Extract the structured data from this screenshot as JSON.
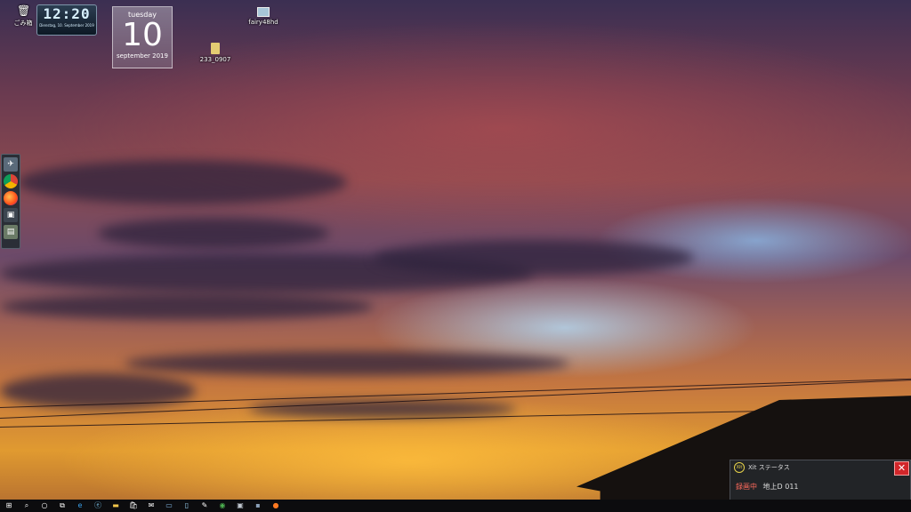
{
  "desktop": {
    "icons": [
      {
        "label": "ごみ箱",
        "icon": "recycle-bin-icon"
      },
      {
        "label": "fairy48hd",
        "icon": "image-file-icon"
      },
      {
        "label": "233_0907",
        "icon": "file-archive-icon"
      }
    ]
  },
  "clock": {
    "time": "12:20",
    "date": "Dienstag, 10. September 2019"
  },
  "calendar": {
    "day": "tuesday",
    "number": "10",
    "month": "september 2019"
  },
  "status_panel": {
    "title": "Xit ステータス",
    "recording": "録画中",
    "channel": "地上D 011",
    "close": "✕"
  },
  "colors": {
    "accent_close": "#d2262a",
    "recording": "#ff6a5c"
  }
}
